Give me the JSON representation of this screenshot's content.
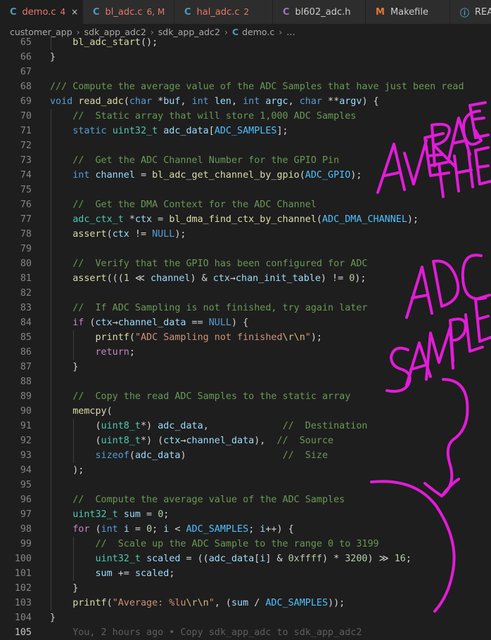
{
  "tabs": [
    {
      "icon": "C",
      "label": "demo.c",
      "badge": "4",
      "close": "×",
      "active": true,
      "color": "#e8786c",
      "iconColor": "#519aba",
      "width": 118
    },
    {
      "icon": "C",
      "label": "bl_adc.c",
      "badge": "6, M",
      "close": "",
      "active": false,
      "color": "#e8786c",
      "iconColor": "#519aba",
      "width": 130
    },
    {
      "icon": "C",
      "label": "hal_adc.c",
      "badge": "2",
      "close": "",
      "active": false,
      "color": "#e8786c",
      "iconColor": "#519aba",
      "width": 140
    },
    {
      "icon": "C",
      "label": "bl602_adc.h",
      "badge": "",
      "close": "",
      "active": false,
      "color": "#cccccc",
      "iconColor": "#a074c4",
      "width": 132
    },
    {
      "icon": "M",
      "label": "Makefile",
      "badge": "",
      "close": "",
      "active": false,
      "color": "#cccccc",
      "iconColor": "#e37933",
      "width": 120
    },
    {
      "icon": "ⓘ",
      "label": "REA",
      "badge": "",
      "close": "",
      "active": false,
      "color": "#cccccc",
      "iconColor": "#519aba",
      "width": 80
    }
  ],
  "breadcrumb": [
    "customer_app",
    "sdk_app_adc2",
    "sdk_app_adc2",
    "demo.c",
    "…"
  ],
  "breadcrumb_file_icon": "C",
  "lines": [
    {
      "no": "65",
      "indent": 1,
      "t": [
        [
          "f",
          "bl_adc_start"
        ],
        [
          "p",
          "();"
        ]
      ]
    },
    {
      "no": "66",
      "indent": 0,
      "t": [
        [
          "p",
          "}"
        ]
      ]
    },
    {
      "no": "67",
      "indent": 0,
      "t": []
    },
    {
      "no": "68",
      "indent": 0,
      "t": [
        [
          "c",
          "/// Compute the average value of the ADC Samples that have just been read"
        ]
      ]
    },
    {
      "no": "69",
      "indent": 0,
      "t": [
        [
          "k",
          "void"
        ],
        [
          "p",
          " "
        ],
        [
          "f",
          "read_adc"
        ],
        [
          "p",
          "("
        ],
        [
          "k",
          "char"
        ],
        [
          "p",
          " *"
        ],
        [
          "v",
          "buf"
        ],
        [
          "p",
          ", "
        ],
        [
          "k",
          "int"
        ],
        [
          "p",
          " "
        ],
        [
          "v",
          "len"
        ],
        [
          "p",
          ", "
        ],
        [
          "k",
          "int"
        ],
        [
          "p",
          " "
        ],
        [
          "v",
          "argc"
        ],
        [
          "p",
          ", "
        ],
        [
          "k",
          "char"
        ],
        [
          "p",
          " **"
        ],
        [
          "v",
          "argv"
        ],
        [
          "p",
          ") {"
        ]
      ]
    },
    {
      "no": "70",
      "indent": 1,
      "t": [
        [
          "c",
          "//  Static array that will store 1,000 ADC Samples"
        ]
      ]
    },
    {
      "no": "71",
      "indent": 1,
      "t": [
        [
          "k",
          "static"
        ],
        [
          "p",
          " "
        ],
        [
          "t",
          "uint32_t"
        ],
        [
          "p",
          " "
        ],
        [
          "v",
          "adc_data"
        ],
        [
          "p",
          "["
        ],
        [
          "m",
          "ADC_SAMPLES"
        ],
        [
          "p",
          "];"
        ]
      ]
    },
    {
      "no": "72",
      "indent": 1,
      "t": []
    },
    {
      "no": "73",
      "indent": 1,
      "t": [
        [
          "c",
          "//  Get the ADC Channel Number for the GPIO Pin"
        ]
      ]
    },
    {
      "no": "74",
      "indent": 1,
      "t": [
        [
          "k",
          "int"
        ],
        [
          "p",
          " "
        ],
        [
          "v",
          "channel"
        ],
        [
          "p",
          " = "
        ],
        [
          "f",
          "bl_adc_get_channel_by_gpio"
        ],
        [
          "p",
          "("
        ],
        [
          "m",
          "ADC_GPIO"
        ],
        [
          "p",
          ");"
        ]
      ]
    },
    {
      "no": "75",
      "indent": 1,
      "t": []
    },
    {
      "no": "76",
      "indent": 1,
      "t": [
        [
          "c",
          "//  Get the DMA Context for the ADC Channel"
        ]
      ]
    },
    {
      "no": "77",
      "indent": 1,
      "t": [
        [
          "t",
          "adc_ctx_t"
        ],
        [
          "p",
          " *"
        ],
        [
          "v",
          "ctx"
        ],
        [
          "p",
          " = "
        ],
        [
          "f",
          "bl_dma_find_ctx_by_channel"
        ],
        [
          "p",
          "("
        ],
        [
          "m",
          "ADC_DMA_CHANNEL"
        ],
        [
          "p",
          ");"
        ]
      ]
    },
    {
      "no": "78",
      "indent": 1,
      "t": [
        [
          "f",
          "assert"
        ],
        [
          "p",
          "("
        ],
        [
          "v",
          "ctx"
        ],
        [
          "p",
          " != "
        ],
        [
          "k",
          "NULL"
        ],
        [
          "p",
          ");"
        ]
      ]
    },
    {
      "no": "79",
      "indent": 1,
      "t": []
    },
    {
      "no": "80",
      "indent": 1,
      "t": [
        [
          "c",
          "//  Verify that the GPIO has been configured for ADC"
        ]
      ]
    },
    {
      "no": "81",
      "indent": 1,
      "t": [
        [
          "f",
          "assert"
        ],
        [
          "p",
          "((("
        ],
        [
          "n",
          "1"
        ],
        [
          "p",
          " ≪ "
        ],
        [
          "v",
          "channel"
        ],
        [
          "p",
          ") & "
        ],
        [
          "v",
          "ctx"
        ],
        [
          "p",
          "→"
        ],
        [
          "v",
          "chan_init_table"
        ],
        [
          "p",
          ") != "
        ],
        [
          "n",
          "0"
        ],
        [
          "p",
          ");"
        ]
      ]
    },
    {
      "no": "82",
      "indent": 1,
      "t": []
    },
    {
      "no": "83",
      "indent": 1,
      "t": [
        [
          "c",
          "//  If ADC Sampling is not finished, try again later"
        ]
      ]
    },
    {
      "no": "84",
      "indent": 1,
      "t": [
        [
          "r",
          "if"
        ],
        [
          "p",
          " ("
        ],
        [
          "v",
          "ctx"
        ],
        [
          "p",
          "→"
        ],
        [
          "v",
          "channel_data"
        ],
        [
          "p",
          " == "
        ],
        [
          "k",
          "NULL"
        ],
        [
          "p",
          ") {"
        ]
      ]
    },
    {
      "no": "85",
      "indent": 2,
      "t": [
        [
          "f",
          "printf"
        ],
        [
          "p",
          "("
        ],
        [
          "s",
          "\"ADC Sampling not finished"
        ],
        [
          "e",
          "\\r\\n"
        ],
        [
          "s",
          "\""
        ],
        [
          "p",
          ");"
        ]
      ]
    },
    {
      "no": "86",
      "indent": 2,
      "t": [
        [
          "r",
          "return"
        ],
        [
          "p",
          ";"
        ]
      ]
    },
    {
      "no": "87",
      "indent": 1,
      "t": [
        [
          "p",
          "}"
        ]
      ]
    },
    {
      "no": "88",
      "indent": 1,
      "t": []
    },
    {
      "no": "89",
      "indent": 1,
      "t": [
        [
          "c",
          "//  Copy the read ADC Samples to the static array"
        ]
      ]
    },
    {
      "no": "90",
      "indent": 1,
      "t": [
        [
          "f",
          "memcpy"
        ],
        [
          "p",
          "("
        ]
      ]
    },
    {
      "no": "91",
      "indent": 2,
      "t": [
        [
          "p",
          "("
        ],
        [
          "t",
          "uint8_t"
        ],
        [
          "p",
          "*) "
        ],
        [
          "v",
          "adc_data"
        ],
        [
          "p",
          ",             "
        ],
        [
          "c",
          "//  Destination"
        ]
      ]
    },
    {
      "no": "92",
      "indent": 2,
      "t": [
        [
          "p",
          "("
        ],
        [
          "t",
          "uint8_t"
        ],
        [
          "p",
          "*) ("
        ],
        [
          "v",
          "ctx"
        ],
        [
          "p",
          "→"
        ],
        [
          "v",
          "channel_data"
        ],
        [
          "p",
          "),  "
        ],
        [
          "c",
          "//  Source"
        ]
      ]
    },
    {
      "no": "93",
      "indent": 2,
      "t": [
        [
          "k",
          "sizeof"
        ],
        [
          "p",
          "("
        ],
        [
          "v",
          "adc_data"
        ],
        [
          "p",
          ")                 "
        ],
        [
          "c",
          "//  Size"
        ]
      ]
    },
    {
      "no": "94",
      "indent": 1,
      "t": [
        [
          "p",
          ");"
        ]
      ]
    },
    {
      "no": "95",
      "indent": 1,
      "t": []
    },
    {
      "no": "96",
      "indent": 1,
      "t": [
        [
          "c",
          "//  Compute the average value of the ADC Samples"
        ]
      ]
    },
    {
      "no": "97",
      "indent": 1,
      "t": [
        [
          "t",
          "uint32_t"
        ],
        [
          "p",
          " "
        ],
        [
          "v",
          "sum"
        ],
        [
          "p",
          " = "
        ],
        [
          "n",
          "0"
        ],
        [
          "p",
          ";"
        ]
      ]
    },
    {
      "no": "98",
      "indent": 1,
      "t": [
        [
          "r",
          "for"
        ],
        [
          "p",
          " ("
        ],
        [
          "k",
          "int"
        ],
        [
          "p",
          " "
        ],
        [
          "v",
          "i"
        ],
        [
          "p",
          " = "
        ],
        [
          "n",
          "0"
        ],
        [
          "p",
          "; "
        ],
        [
          "v",
          "i"
        ],
        [
          "p",
          " < "
        ],
        [
          "m",
          "ADC_SAMPLES"
        ],
        [
          "p",
          "; "
        ],
        [
          "v",
          "i"
        ],
        [
          "p",
          "++) {"
        ]
      ]
    },
    {
      "no": "99",
      "indent": 2,
      "t": [
        [
          "c",
          "//  Scale up the ADC Sample to the range 0 to 3199"
        ]
      ]
    },
    {
      "no": "100",
      "indent": 2,
      "t": [
        [
          "t",
          "uint32_t"
        ],
        [
          "p",
          " "
        ],
        [
          "v",
          "scaled"
        ],
        [
          "p",
          " = (("
        ],
        [
          "v",
          "adc_data"
        ],
        [
          "p",
          "["
        ],
        [
          "v",
          "i"
        ],
        [
          "p",
          "] & "
        ],
        [
          "n",
          "0xffff"
        ],
        [
          "p",
          ") * "
        ],
        [
          "n",
          "3200"
        ],
        [
          "p",
          ") ≫ "
        ],
        [
          "n",
          "16"
        ],
        [
          "p",
          ";"
        ]
      ]
    },
    {
      "no": "101",
      "indent": 2,
      "t": [
        [
          "v",
          "sum"
        ],
        [
          "p",
          " += "
        ],
        [
          "v",
          "scaled"
        ],
        [
          "p",
          ";"
        ]
      ]
    },
    {
      "no": "102",
      "indent": 1,
      "t": [
        [
          "p",
          "}"
        ]
      ]
    },
    {
      "no": "103",
      "indent": 1,
      "t": [
        [
          "f",
          "printf"
        ],
        [
          "p",
          "("
        ],
        [
          "s",
          "\"Average: %lu"
        ],
        [
          "e",
          "\\r\\n"
        ],
        [
          "s",
          "\""
        ],
        [
          "p",
          ", ("
        ],
        [
          "v",
          "sum"
        ],
        [
          "p",
          " / "
        ],
        [
          "m",
          "ADC_SAMPLES"
        ],
        [
          "p",
          "));"
        ]
      ]
    },
    {
      "no": "104",
      "indent": 0,
      "t": [
        [
          "p",
          "}"
        ]
      ]
    },
    {
      "no": "105",
      "indent": 0,
      "current": true,
      "t": [
        [
          "blame",
          "    You, 2 hours ago • Copy sdk_app_adc to sdk_app_adc2"
        ]
      ]
    }
  ],
  "annotation": {
    "text_lines": [
      "AVERAGE",
      "THE",
      "ADC",
      "SAMPLES"
    ],
    "color": "#e31bd9"
  }
}
